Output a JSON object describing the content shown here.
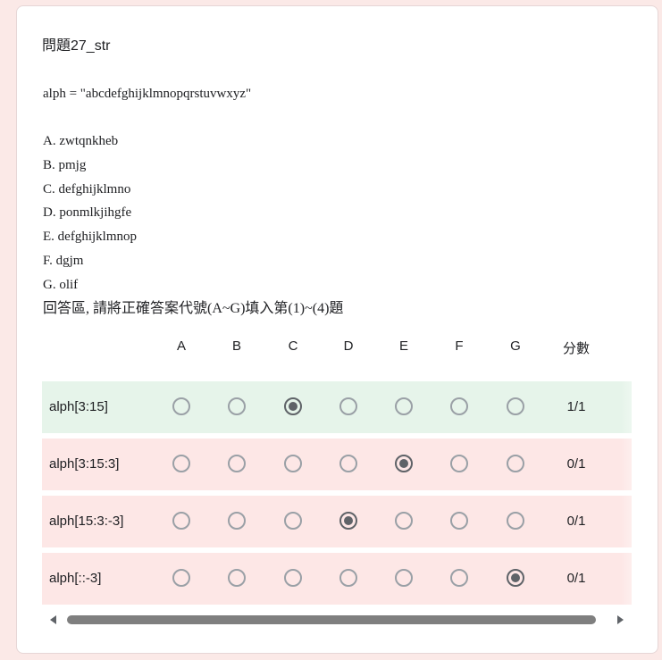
{
  "question": {
    "title": "問題27_str",
    "assignment": "alph = \"abcdefghijklmnopqrstuvwxyz\"",
    "options": [
      "A. zwtqnkheb",
      "B. pmjg",
      "C. defghijklmno",
      "D. ponmlkjihgfe",
      "E. defghijklmnop",
      "F. dgjm",
      "G. olif"
    ],
    "instruction": "回答區, 請將正確答案代號(A~G)填入第(1)~(4)題"
  },
  "grid": {
    "columns": [
      "A",
      "B",
      "C",
      "D",
      "E",
      "F",
      "G"
    ],
    "score_header": "分數",
    "rows": [
      {
        "label": "alph[3:15]",
        "selected": "C",
        "score": "1/1",
        "correct": true,
        "mark": "✓"
      },
      {
        "label": "alph[3:15:3]",
        "selected": "E",
        "score": "0/1",
        "correct": false,
        "mark": "✕"
      },
      {
        "label": "alph[15:3:-3]",
        "selected": "D",
        "score": "0/1",
        "correct": false,
        "mark": "✕"
      },
      {
        "label": "alph[::-3]",
        "selected": "G",
        "score": "0/1",
        "correct": false,
        "mark": "✕"
      }
    ]
  },
  "colors": {
    "page_bg": "#fbe9e7",
    "correct_row": "#e6f4ea",
    "incorrect_row": "#fde7e6",
    "check_green": "#1e8e3e",
    "cross_red": "#d93025"
  },
  "icons": {
    "correct": "check-icon",
    "incorrect": "close-icon",
    "scroll_left": "arrow-left-icon",
    "scroll_right": "arrow-right-icon"
  }
}
